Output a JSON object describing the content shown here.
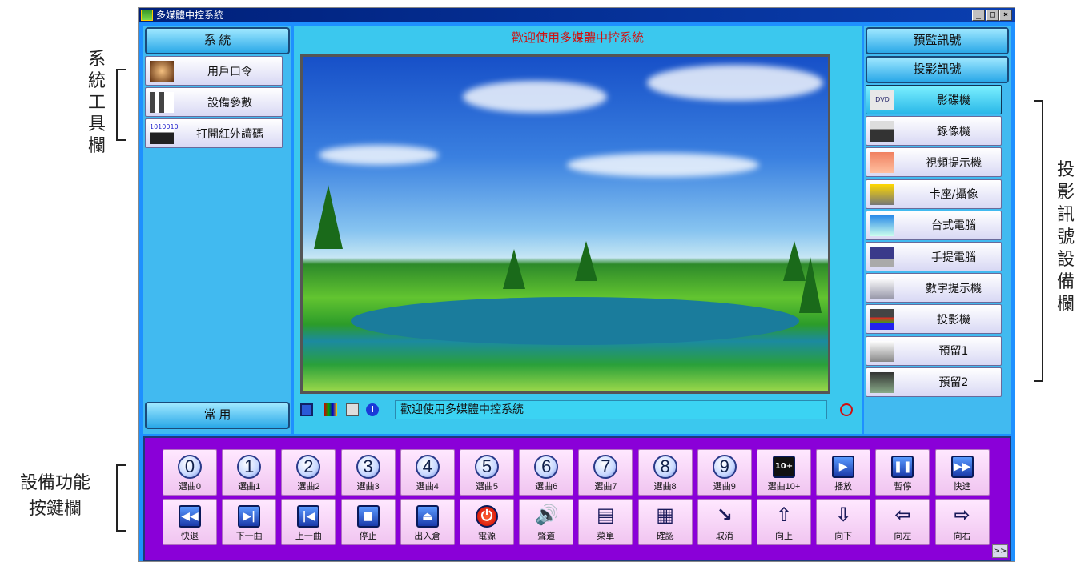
{
  "annotations": {
    "left_top": [
      "系",
      "統",
      "工",
      "具",
      "欄"
    ],
    "left_bottom": [
      "設備功能",
      "按鍵欄"
    ],
    "right": [
      "投",
      "影",
      "訊",
      "號",
      "設",
      "備",
      "欄"
    ]
  },
  "window": {
    "title": "多媒體中控系統",
    "controls": [
      "_",
      "□",
      "×"
    ]
  },
  "left": {
    "header": "系 統",
    "footer": "常 用",
    "items": [
      {
        "label": "用戶口令",
        "icon": "user-key-icon"
      },
      {
        "label": "設備參數",
        "icon": "device-parameters-icon"
      },
      {
        "label": "打開紅外讀碼",
        "icon": "infrared-chip-icon",
        "icon_text": "1010010"
      }
    ]
  },
  "center": {
    "welcome_title": "歡迎使用多媒體中控系統",
    "status_text": "歡迎使用多媒體中控系統"
  },
  "right": {
    "header_preview": "預監訊號",
    "header_projection": "投影訊號",
    "items": [
      {
        "label": "影碟機",
        "icon": "dvd-player-icon",
        "icon_text": "DVD"
      },
      {
        "label": "錄像機",
        "icon": "vcr-icon"
      },
      {
        "label": "視頻提示機",
        "icon": "video-presenter-icon"
      },
      {
        "label": "卡座/攝像",
        "icon": "camera-deck-icon"
      },
      {
        "label": "台式電腦",
        "icon": "desktop-computer-icon"
      },
      {
        "label": "手提電腦",
        "icon": "laptop-icon"
      },
      {
        "label": "數字提示機",
        "icon": "digital-presenter-icon"
      },
      {
        "label": "投影機",
        "icon": "projector-icon"
      },
      {
        "label": "預留1",
        "icon": "reserved-1-icon"
      },
      {
        "label": "預留2",
        "icon": "reserved-2-icon"
      }
    ],
    "selected_index": 0
  },
  "keys": {
    "row1": [
      {
        "label": "選曲0",
        "glyph": "0"
      },
      {
        "label": "選曲1",
        "glyph": "1"
      },
      {
        "label": "選曲2",
        "glyph": "2"
      },
      {
        "label": "選曲3",
        "glyph": "3"
      },
      {
        "label": "選曲4",
        "glyph": "4"
      },
      {
        "label": "選曲5",
        "glyph": "5"
      },
      {
        "label": "選曲6",
        "glyph": "6"
      },
      {
        "label": "選曲7",
        "glyph": "7"
      },
      {
        "label": "選曲8",
        "glyph": "8"
      },
      {
        "label": "選曲9",
        "glyph": "9"
      },
      {
        "label": "選曲10+",
        "glyph": "10+"
      },
      {
        "label": "播放",
        "glyph": "▶"
      },
      {
        "label": "暫停",
        "glyph": "❚❚"
      },
      {
        "label": "快進",
        "glyph": "▶▶"
      }
    ],
    "row2": [
      {
        "label": "快退",
        "glyph": "◀◀"
      },
      {
        "label": "下一曲",
        "glyph": "▶|"
      },
      {
        "label": "上一曲",
        "glyph": "|◀"
      },
      {
        "label": "停止",
        "glyph": "■"
      },
      {
        "label": "出入倉",
        "glyph": "⏏"
      },
      {
        "label": "電源",
        "glyph": "⏻"
      },
      {
        "label": "聲道",
        "glyph": "🔊"
      },
      {
        "label": "菜單",
        "glyph": "▤"
      },
      {
        "label": "確認",
        "glyph": "▦"
      },
      {
        "label": "取消",
        "glyph": "↘"
      },
      {
        "label": "向上",
        "glyph": "⇧"
      },
      {
        "label": "向下",
        "glyph": "⇩"
      },
      {
        "label": "向左",
        "glyph": "⇦"
      },
      {
        "label": "向右",
        "glyph": "⇨"
      }
    ],
    "more": ">>"
  },
  "colors": {
    "window_bg": "#1e90ff",
    "panel": "#41baf0",
    "keypad_bg": "#8a00d8",
    "welcome_red": "#d01010"
  }
}
